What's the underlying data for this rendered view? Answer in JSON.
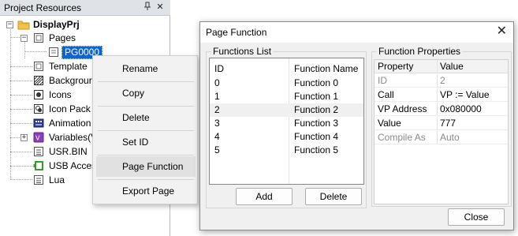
{
  "panel": {
    "title": "Project Resources",
    "pin_glyph": "📌",
    "close_glyph": "✕",
    "tree": {
      "root": "DisplayPrj",
      "pages": "Pages",
      "page_item": "PG0000",
      "template": "Template",
      "background": "Backgrour",
      "icons": "Icons",
      "icon_pack": "Icon Pack",
      "animation": "Animation",
      "variables": "Variables(V",
      "usr_bin": "USR.BIN",
      "usb_access": "USB Acces",
      "lua": "Lua"
    }
  },
  "context_menu": {
    "items": [
      "Rename",
      "Copy",
      "Delete",
      "Set ID",
      "Page Function",
      "Export Page"
    ],
    "highlighted": "Page Function"
  },
  "dialog": {
    "title": "Page Function",
    "close_glyph": "✕",
    "functions_group": "Functions List",
    "list_headers": [
      "ID",
      "Function Name"
    ],
    "list_rows": [
      {
        "id": "0",
        "name": "Function 0"
      },
      {
        "id": "1",
        "name": "Function 1"
      },
      {
        "id": "2",
        "name": "Function 2"
      },
      {
        "id": "3",
        "name": "Function 3"
      },
      {
        "id": "4",
        "name": "Function 4"
      },
      {
        "id": "5",
        "name": "Function 5"
      }
    ],
    "selected_row": "2",
    "add_label": "Add",
    "delete_label": "Delete",
    "props_group": "Function Properties",
    "props_headers": [
      "Property",
      "Value"
    ],
    "props_rows": [
      {
        "property": "ID",
        "value": "2",
        "disabled": true
      },
      {
        "property": "Call",
        "value": "VP := Value",
        "disabled": false
      },
      {
        "property": "VP Address",
        "value": "0x080000",
        "disabled": false
      },
      {
        "property": "Value",
        "value": "777",
        "disabled": false
      },
      {
        "property": "Compile As",
        "value": "Auto",
        "disabled": true
      }
    ],
    "close_label": "Close"
  },
  "colors": {
    "selection": "#0a64d8",
    "panel_header": "#dfe3e8",
    "dialog_bg": "#f0f0f0",
    "menu_bg": "#f2f2f2",
    "folder": "#f2c14e",
    "variables_icon": "#8b3fb8",
    "usb_icon": "#2f9e2f"
  }
}
